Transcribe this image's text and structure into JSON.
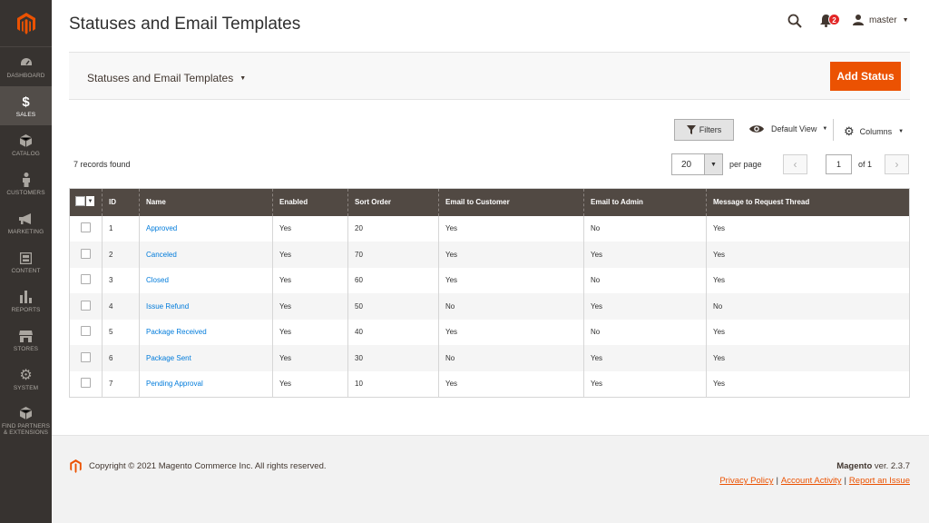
{
  "sidebar": {
    "items": [
      {
        "label": "Dashboard",
        "icon": "dashboard-icon"
      },
      {
        "label": "Sales",
        "icon": "dollar-icon"
      },
      {
        "label": "Catalog",
        "icon": "cube-icon"
      },
      {
        "label": "Customers",
        "icon": "person-icon"
      },
      {
        "label": "Marketing",
        "icon": "megaphone-icon"
      },
      {
        "label": "Content",
        "icon": "layout-icon"
      },
      {
        "label": "Reports",
        "icon": "bar-chart-icon"
      },
      {
        "label": "Stores",
        "icon": "store-icon"
      },
      {
        "label": "System",
        "icon": "gear-icon"
      },
      {
        "label": "Find Partners & Extensions",
        "icon": "box-icon"
      }
    ]
  },
  "header": {
    "title": "Statuses and Email Templates",
    "notifications_count": "2",
    "username": "master"
  },
  "actions": {
    "store_switcher": "Statuses and Email Templates",
    "add_button": "Add Status"
  },
  "grid_controls": {
    "filters": "Filters",
    "view": "Default View",
    "columns": "Columns",
    "records_found": "7 records found",
    "per_page_value": "20",
    "per_page_label": "per page",
    "current_page": "1",
    "of_pages": "of 1"
  },
  "table": {
    "headers": [
      "ID",
      "Name",
      "Enabled",
      "Sort Order",
      "Email to Customer",
      "Email to Admin",
      "Message to Request Thread"
    ],
    "rows": [
      {
        "id": "1",
        "name": "Approved",
        "enabled": "Yes",
        "sort": "20",
        "cust": "Yes",
        "admin": "No",
        "thread": "Yes"
      },
      {
        "id": "2",
        "name": "Canceled",
        "enabled": "Yes",
        "sort": "70",
        "cust": "Yes",
        "admin": "Yes",
        "thread": "Yes"
      },
      {
        "id": "3",
        "name": "Closed",
        "enabled": "Yes",
        "sort": "60",
        "cust": "Yes",
        "admin": "No",
        "thread": "Yes"
      },
      {
        "id": "4",
        "name": "Issue Refund",
        "enabled": "Yes",
        "sort": "50",
        "cust": "No",
        "admin": "Yes",
        "thread": "No"
      },
      {
        "id": "5",
        "name": "Package Received",
        "enabled": "Yes",
        "sort": "40",
        "cust": "Yes",
        "admin": "No",
        "thread": "Yes"
      },
      {
        "id": "6",
        "name": "Package Sent",
        "enabled": "Yes",
        "sort": "30",
        "cust": "No",
        "admin": "Yes",
        "thread": "Yes"
      },
      {
        "id": "7",
        "name": "Pending Approval",
        "enabled": "Yes",
        "sort": "10",
        "cust": "Yes",
        "admin": "Yes",
        "thread": "Yes"
      }
    ]
  },
  "footer": {
    "copyright": "Copyright © 2021 Magento Commerce Inc. All rights reserved.",
    "brand": "Magento",
    "version": " ver. 2.3.7",
    "privacy": "Privacy Policy",
    "activity": "Account Activity",
    "report": "Report an Issue"
  },
  "colors": {
    "accent": "#eb5202",
    "sidebar": "#373330",
    "table_header": "#514943",
    "link": "#007bdb"
  }
}
